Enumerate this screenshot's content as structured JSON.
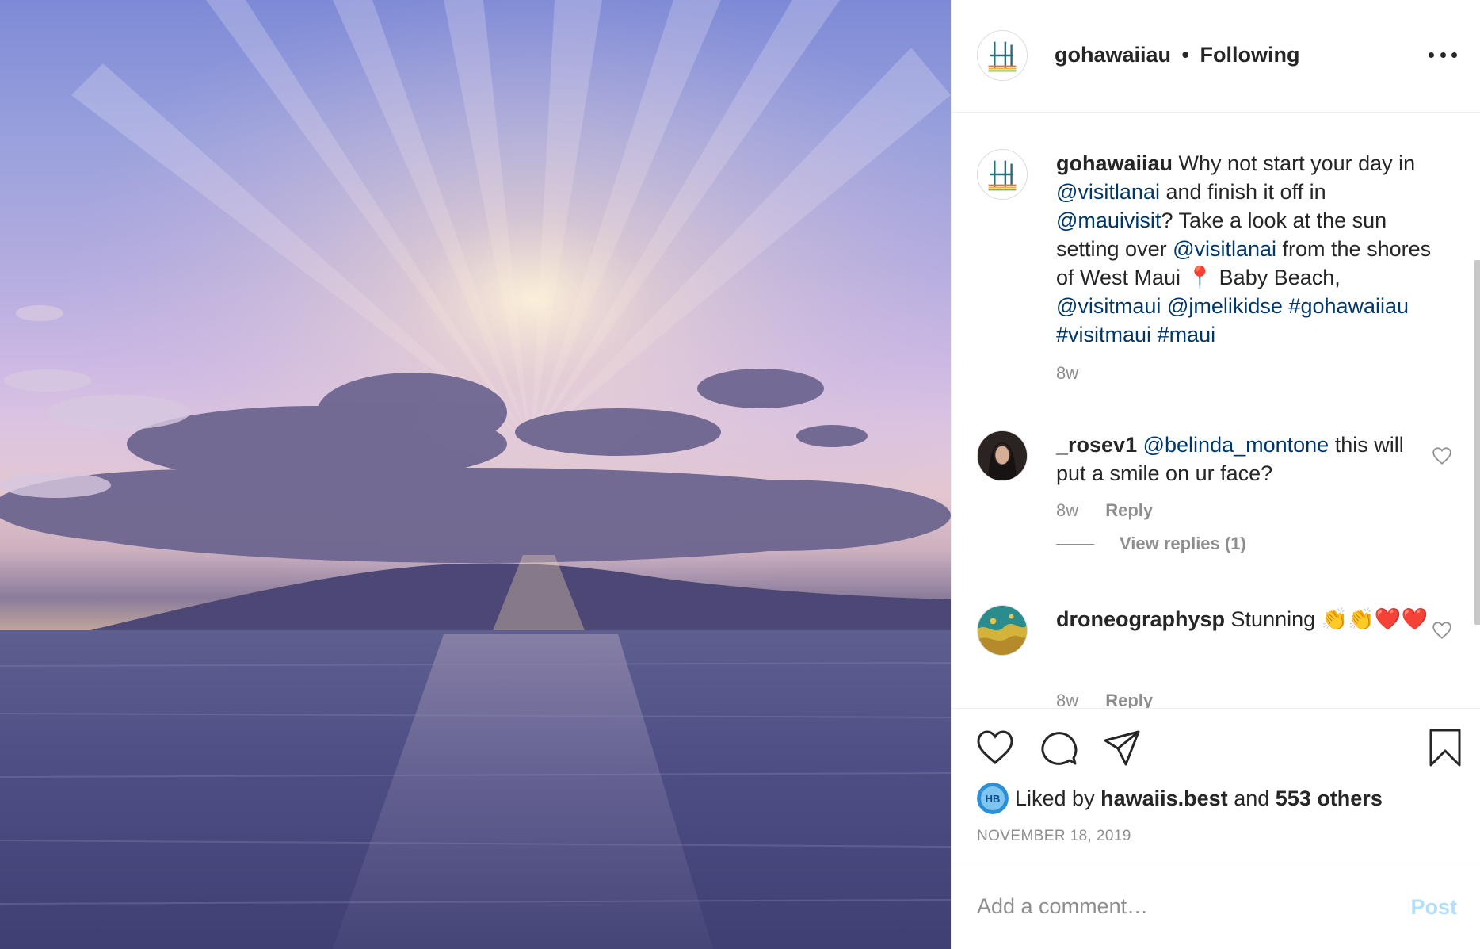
{
  "post": {
    "photo_alt": "Sunset over Lanai from West Maui",
    "header": {
      "username": "gohawaiiau",
      "separator": "•",
      "follow_status": "Following"
    },
    "caption": {
      "username": "gohawaiiau",
      "parts": [
        {
          "text": "Why not start your day in ",
          "type": "text"
        },
        {
          "text": "@visitlanai",
          "type": "mention"
        },
        {
          "text": " and finish it off in ",
          "type": "text"
        },
        {
          "text": "@mauivisit",
          "type": "mention"
        },
        {
          "text": "? Take a look at the sun setting over ",
          "type": "text"
        },
        {
          "text": "@visitlanai",
          "type": "mention"
        },
        {
          "text": " from the shores of West Maui 📍 Baby Beach, ",
          "type": "text"
        },
        {
          "text": "@visitmaui",
          "type": "mention"
        },
        {
          "text": " ",
          "type": "text"
        },
        {
          "text": "@jmelikidse",
          "type": "mention"
        },
        {
          "text": " ",
          "type": "text"
        },
        {
          "text": "#gohawaiiau",
          "type": "mention"
        },
        {
          "text": " ",
          "type": "text"
        },
        {
          "text": "#visitmaui",
          "type": "mention"
        },
        {
          "text": " ",
          "type": "text"
        },
        {
          "text": "#maui",
          "type": "mention"
        }
      ],
      "age": "8w"
    },
    "comments": [
      {
        "username": "_rosev1",
        "parts": [
          {
            "text": "@belinda_montone",
            "type": "mention"
          },
          {
            "text": " this will put a smile on ur face?",
            "type": "text"
          }
        ],
        "age": "8w",
        "reply_label": "Reply",
        "view_replies": "View replies (1)"
      },
      {
        "username": "droneographysp",
        "parts": [
          {
            "text": "Stunning 👏👏",
            "type": "text"
          },
          {
            "text": "❤️❤️",
            "type": "text"
          }
        ],
        "age": "8w",
        "reply_label": "Reply"
      }
    ],
    "likes": {
      "prefix": "Liked by",
      "liked_by_user": "hawaiis.best",
      "joiner": "and",
      "others": "553 others",
      "badge": "HB"
    },
    "date": "NOVEMBER 18, 2019",
    "add_comment": {
      "placeholder": "Add a comment…",
      "post_label": "Post"
    },
    "icons": {
      "like": "heart-icon",
      "comment": "comment-icon",
      "share": "paper-plane-icon",
      "save": "bookmark-icon",
      "more": "more-horizontal-icon"
    },
    "colors": {
      "mention": "#00376b",
      "secondary": "#8e8e8e",
      "post_disabled": "#b2dffc"
    }
  }
}
